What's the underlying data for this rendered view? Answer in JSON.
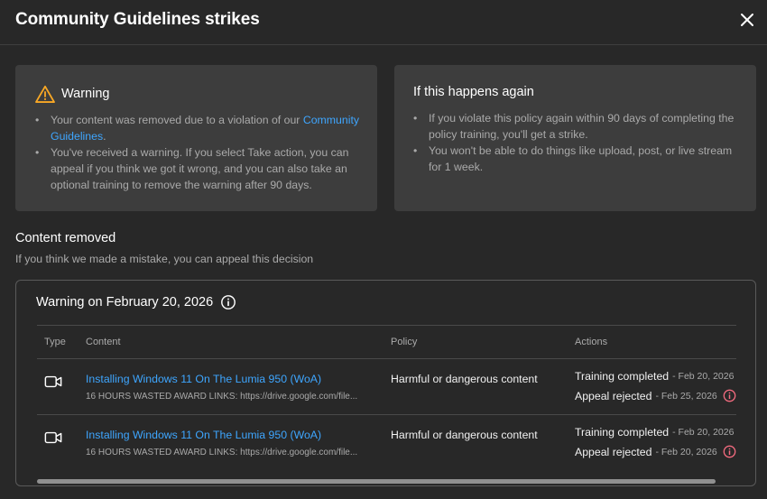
{
  "header": {
    "title": "Community Guidelines strikes"
  },
  "warning_card": {
    "title": "Warning",
    "bullet1_text": "Your content was removed due to a violation of our ",
    "bullet1_link": "Community Guidelines",
    "bullet1_end": ".",
    "bullet2": "You've received a warning. If you select Take action, you can appeal if you think we got it wrong, and you can also take an optional training to remove the warning after 90 days."
  },
  "again_card": {
    "title": "If this happens again",
    "bullet1": "If you violate this policy again within 90 days of completing the policy training, you'll get a strike.",
    "bullet2": "You won't be able to do things like upload, post, or live stream for 1 week."
  },
  "section": {
    "title": "Content removed",
    "subtitle": "If you think we made a mistake, you can appeal this decision"
  },
  "strike_box": {
    "title": "Warning on February 20, 2026",
    "columns": {
      "type": "Type",
      "content": "Content",
      "policy": "Policy",
      "actions": "Actions"
    },
    "rows": [
      {
        "type_icon": "video-camera-icon",
        "title": "Installing Windows 11 On The Lumia 950 (WoA)",
        "desc": "16 HOURS WASTED AWARD LINKS: https://drive.google.com/file...",
        "policy": "Harmful or dangerous content",
        "action1": "Training completed",
        "action1_date": "- Feb 20, 2026",
        "action2": "Appeal rejected",
        "action2_date": "- Feb 25, 2026"
      },
      {
        "type_icon": "video-camera-icon",
        "title": "Installing Windows 11 On The Lumia 950 (WoA)",
        "desc": "16 HOURS WASTED AWARD LINKS: https://drive.google.com/file...",
        "policy": "Harmful or dangerous content",
        "action1": "Training completed",
        "action1_date": "- Feb 20, 2026",
        "action2": "Appeal rejected",
        "action2_date": "- Feb 20, 2026"
      }
    ]
  },
  "colors": {
    "background": "#282828",
    "card": "#3d3d3d",
    "link": "#3ea6ff",
    "warning": "#f9a825",
    "error": "#f36b7f"
  }
}
